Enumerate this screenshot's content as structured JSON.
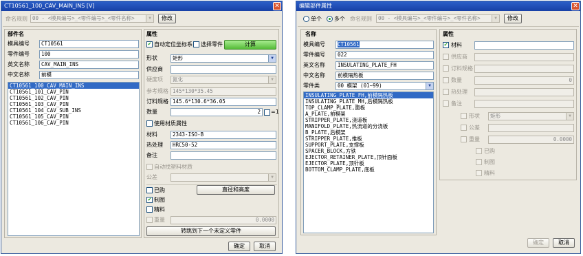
{
  "left_dialog": {
    "title": "CT10561_100_CAV_MAIN_INS [V]",
    "naming_rule_label": "命名规则",
    "naming_rule_value": "00 - <模具编号>_<零件编号>_<零件名称>",
    "modify_button": "修改",
    "parts_header": "部件名",
    "mold_no_label": "模具编号",
    "mold_no_value": "CT10561",
    "part_no_label": "零件编号",
    "part_no_value": "100",
    "en_name_label": "英文名称",
    "en_name_value": "CAV_MAIN_INS",
    "cn_name_label": "中文名称",
    "cn_name_value": "前模",
    "part_list": [
      "CT10561_100_CAV_MAIN_INS",
      "CT10561_101_CAV_PIN",
      "CT10561_102_CAV_PIN",
      "CT10561_103_CAV_PIN",
      "CT10561_104_CAV_SUB_INS",
      "CT10561_105_CAV_PIN",
      "CT10561_106_CAV_PIN"
    ],
    "props_header": "属性",
    "auto_csys_label": "自动定位坐标系",
    "select_part_label": "选择零件",
    "calc_button": "计算",
    "shape_label": "形状",
    "shape_value": "矩形",
    "supplier_label": "供应商",
    "supplier_value": "",
    "hardness_label": "硬度项",
    "hardness_value": "氮化",
    "ref_spec_label": "参考规格",
    "ref_spec_value": "145*130*35.45",
    "order_spec_label": "订料规格",
    "order_spec_value": "145.6*130.6*36.05",
    "qty_label": "数量",
    "qty_value": "2",
    "qty_suffix": "=1",
    "use_material_label": "使用材质属性",
    "material_label": "材料",
    "material_value": "2343-ISO-B",
    "heat_label": "热处理",
    "heat_value": "HRC50-52",
    "note_label": "备注",
    "note_value": "",
    "auto_mat_label": "自动找塑料材质",
    "tolerance_label": "公差",
    "tolerance_value": "",
    "purchased_label": "已购",
    "drawing_label": "制图",
    "precision_label": "精料",
    "weight_label": "重量",
    "weight_value": "0.0000",
    "diameter_button": "直径和高度",
    "goto_next_button": "转跳到下一个未定义零件",
    "ok_button": "确定",
    "cancel_button": "取消"
  },
  "right_dialog": {
    "title": "编辑部件属性",
    "single_label": "单个",
    "multi_label": "多个",
    "naming_rule_label": "命名规则",
    "naming_rule_value": "00 - <模具编号>_<零件编号>_<零件名称>",
    "modify_button": "修改",
    "name_header": "名称",
    "mold_no_label": "模具编号",
    "mold_no_value": "CT10561",
    "part_no_label": "零件编号",
    "part_no_value": "022",
    "en_name_label": "英文名称",
    "en_name_value": "INSULATING_PLATE_FH",
    "cn_name_label": "中文名称",
    "cn_name_value": "前模隔热板",
    "part_type_label": "零件类",
    "part_type_value": "00 模架 (01~99)",
    "type_list": [
      "INSULATING_PLATE_FH,前模隔热板",
      "INSULATING_PLATE_MH,后模隔热板",
      "TOP_CLAMP_PLATE,面板",
      "A_PLATE,前模架",
      "STRIPPER_PLATE,浇道板",
      "MANIFOLD_PLATE,热流道的分浇板",
      "B_PLATE,后模架",
      "STRIPPER_PLATE,推板",
      "SUPPORT_PLATE,支撑板",
      "SPACER_BLOCK,方铁",
      "EJECTOR_RETAINER_PLATE,顶针面板",
      "EJECTOR_PLATE,顶针板",
      "BOTTOM_CLAMP_PLATE,底板"
    ],
    "props_header": "属性",
    "material_label": "材料",
    "material_value": "",
    "supplier_label": "供应商",
    "order_spec_label": "订料规格",
    "qty_label": "数量",
    "qty_value": "0",
    "heat_label": "热处理",
    "note_label": "备注",
    "shape_label": "形状",
    "shape_value": "矩形",
    "tolerance_label": "公差",
    "weight_label": "重量",
    "weight_value": "0.0000",
    "purchased_label": "已购",
    "drawing_label": "制图",
    "precision_label": "精料",
    "ok_button": "确定",
    "cancel_button": "取消"
  }
}
